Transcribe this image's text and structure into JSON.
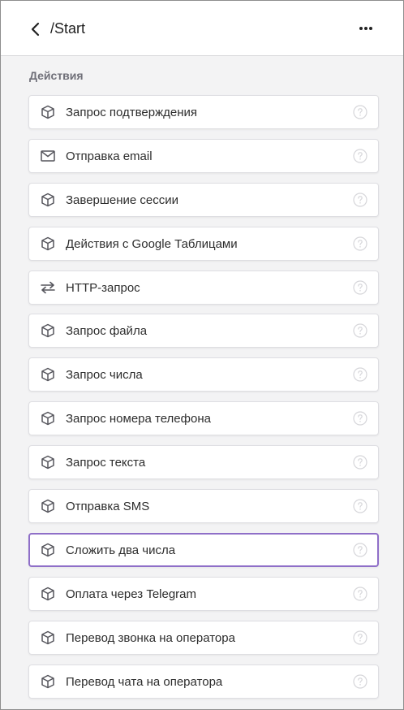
{
  "header": {
    "title": "/Start"
  },
  "section": {
    "label": "Действия"
  },
  "items": [
    {
      "label": "Запрос подтверждения",
      "icon": "cube-icon"
    },
    {
      "label": "Отправка email",
      "icon": "envelope-icon"
    },
    {
      "label": "Завершение сессии",
      "icon": "cube-icon"
    },
    {
      "label": "Действия с Google Таблицами",
      "icon": "cube-icon"
    },
    {
      "label": "HTTP-запрос",
      "icon": "swap-arrows-icon"
    },
    {
      "label": "Запрос файла",
      "icon": "cube-icon"
    },
    {
      "label": "Запрос числа",
      "icon": "cube-icon"
    },
    {
      "label": "Запрос номера телефона",
      "icon": "cube-icon"
    },
    {
      "label": "Запрос текста",
      "icon": "cube-icon"
    },
    {
      "label": "Отправка SMS",
      "icon": "cube-icon"
    },
    {
      "label": "Сложить два числа",
      "icon": "cube-icon",
      "selected": true
    },
    {
      "label": "Оплата через Telegram",
      "icon": "cube-icon"
    },
    {
      "label": "Перевод звонка на оператора",
      "icon": "cube-icon"
    },
    {
      "label": "Перевод чата на оператора",
      "icon": "cube-icon"
    }
  ],
  "colors": {
    "selected_border": "#8f6fc8",
    "background": "#f3f3f4",
    "icon": "#55555c",
    "help_icon": "#d6d6da"
  }
}
